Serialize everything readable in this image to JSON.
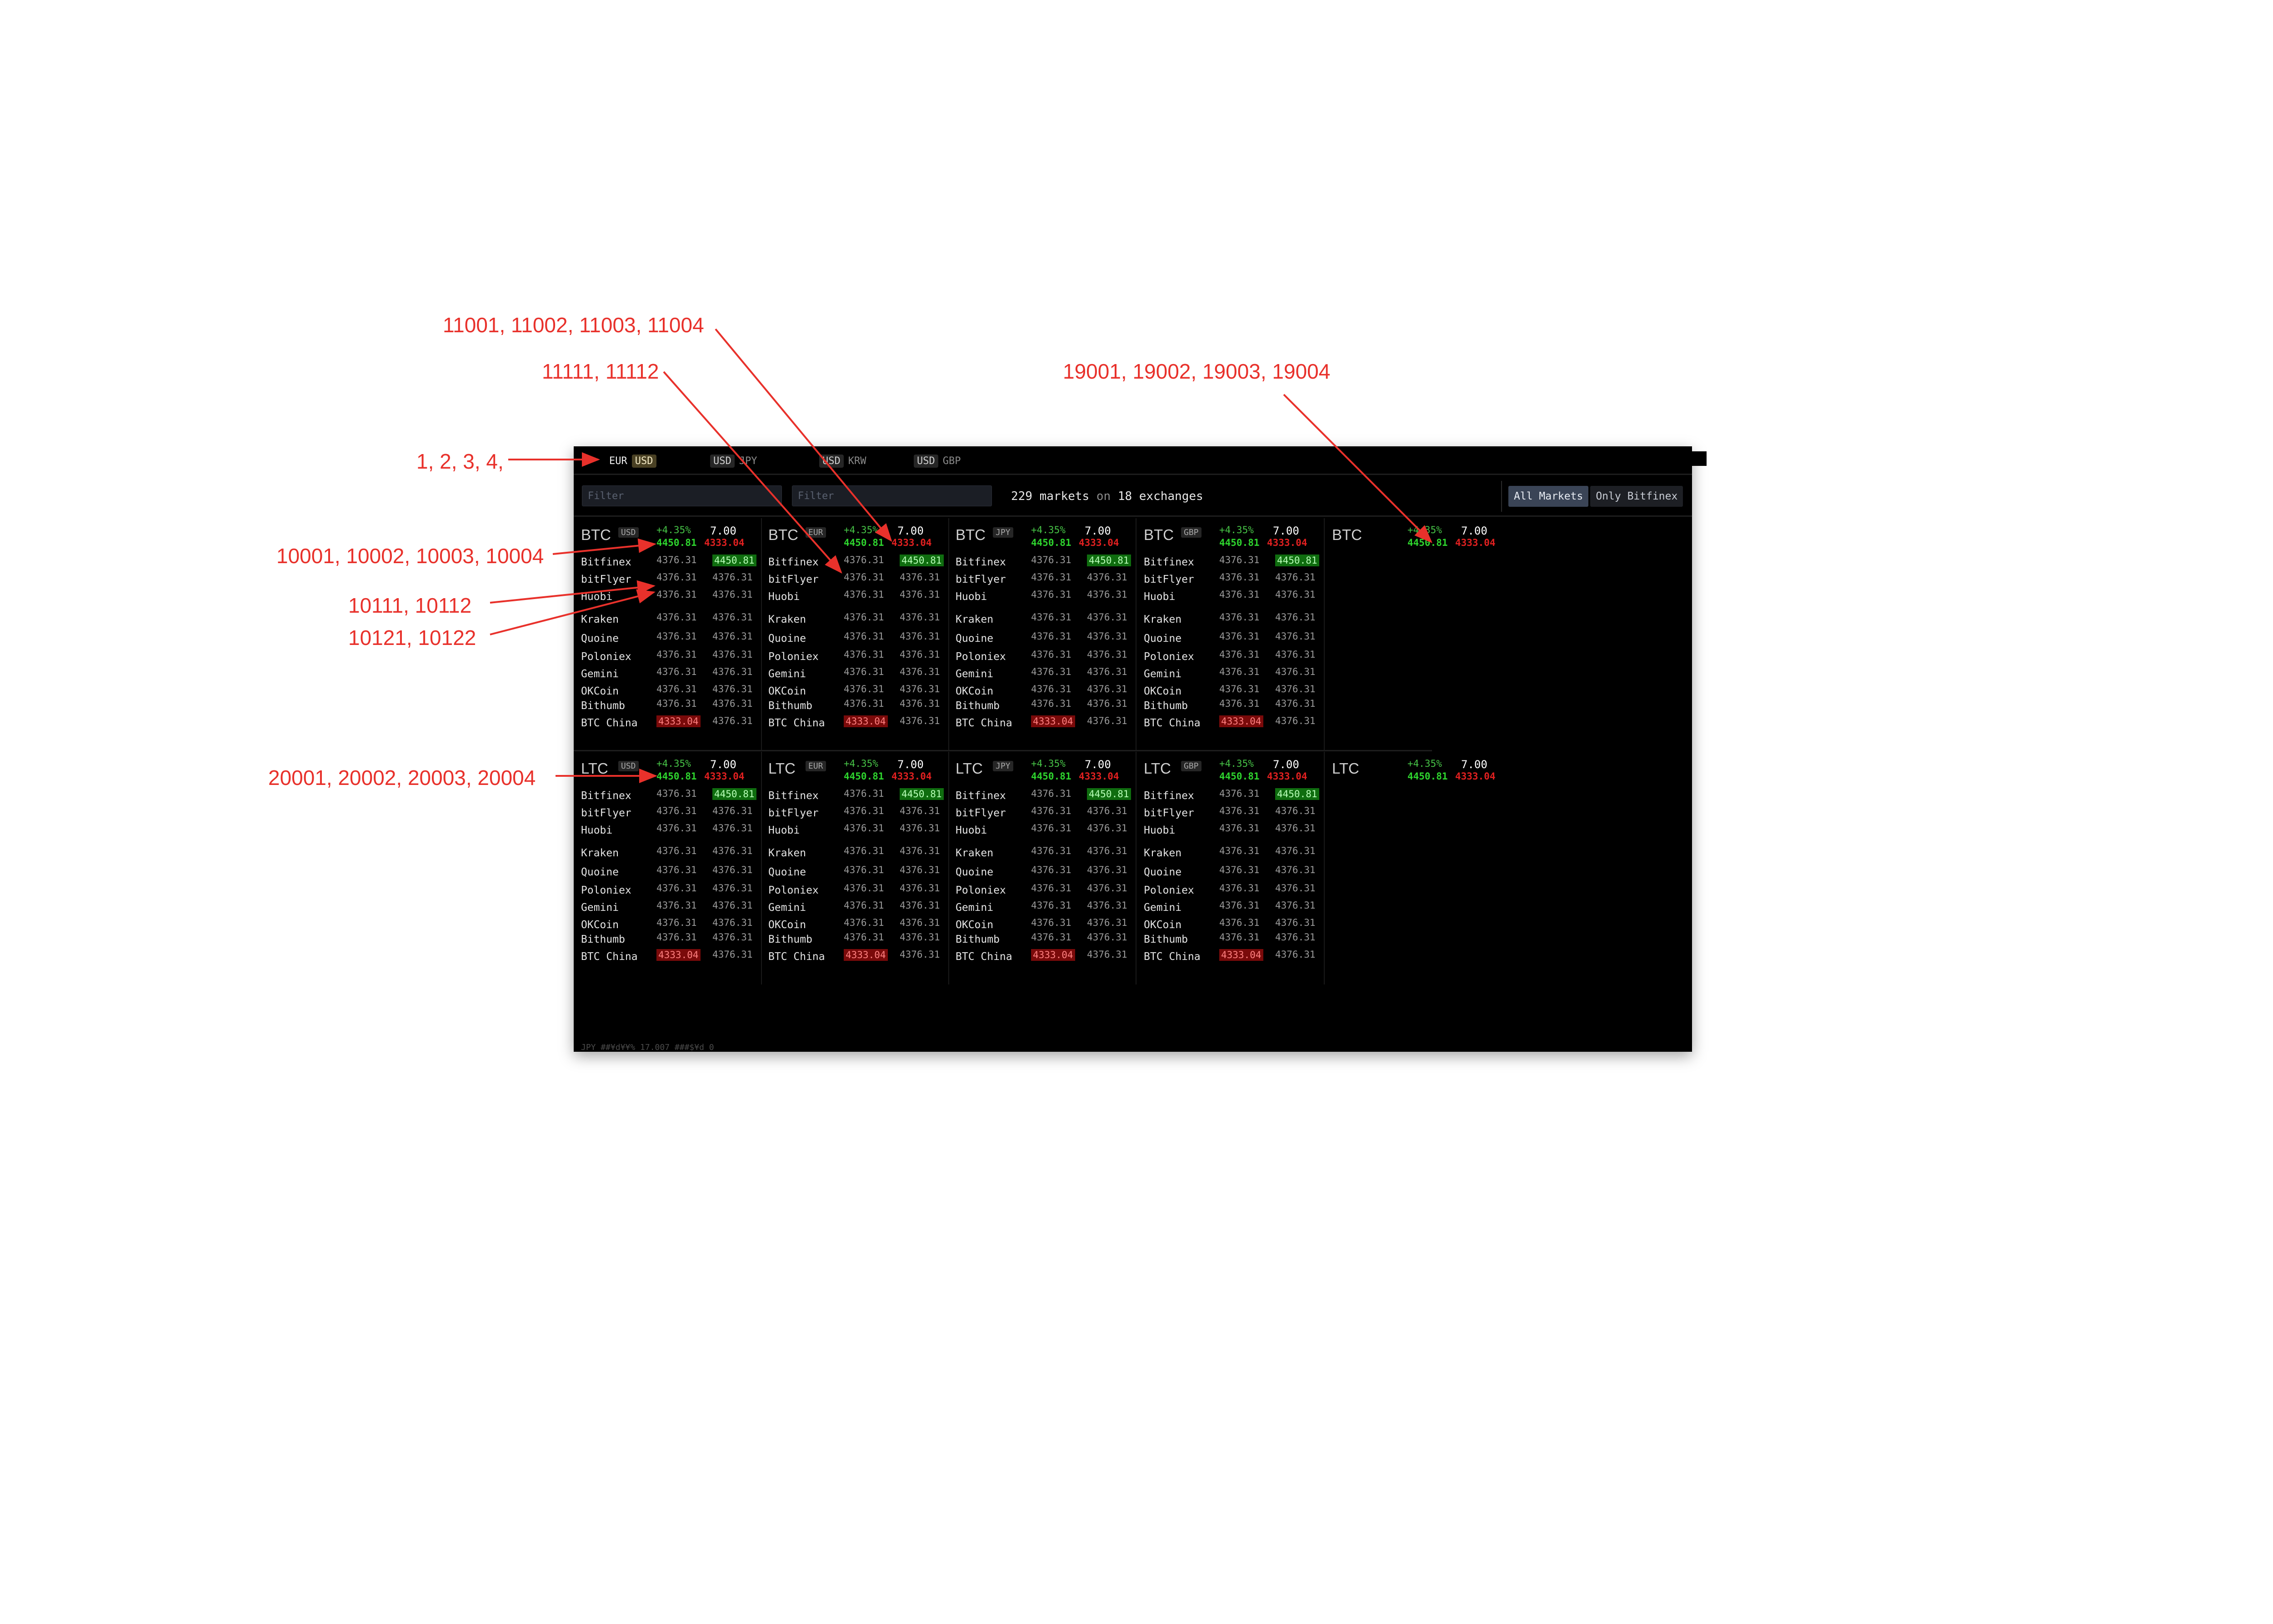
{
  "annotations": {
    "a_top_tabs": "1, 2, 3, 4,",
    "a_11001": "11001, 11002, 11003, 11004",
    "a_11111": "11111, 11112",
    "a_19001": "19001, 19002, 19003, 19004",
    "a_10001": "10001, 10002, 10003, 10004",
    "a_10111": "10111, 10112",
    "a_10121": "10121, 10122",
    "a_20001": "20001, 20002, 20003, 20004"
  },
  "tabs": [
    {
      "left": "EUR",
      "right": "USD",
      "active": true
    },
    {
      "left": "USD",
      "right": "JPY",
      "active": false
    },
    {
      "left": "USD",
      "right": "KRW",
      "active": false
    },
    {
      "left": "USD",
      "right": "GBP",
      "active": false
    }
  ],
  "toolbar": {
    "filter1_placeholder": "Filter",
    "filter2_placeholder": "Filter",
    "markets_count": "229 markets",
    "on_word": "on",
    "exchanges_count": "18 exchanges",
    "all_markets_label": "All Markets",
    "only_bitfinex_label": "Only Bitfinex"
  },
  "panel_header": {
    "change": "+4.35%",
    "value": "7.00",
    "bid": "4450.81",
    "ask": "4333.04"
  },
  "btc_panels": [
    {
      "base": "BTC",
      "quote": "USD"
    },
    {
      "base": "BTC",
      "quote": "EUR"
    },
    {
      "base": "BTC",
      "quote": "JPY"
    },
    {
      "base": "BTC",
      "quote": "GBP"
    },
    {
      "base": "BTC",
      "quote": ""
    }
  ],
  "ltc_panels": [
    {
      "base": "LTC",
      "quote": "USD"
    },
    {
      "base": "LTC",
      "quote": "EUR"
    },
    {
      "base": "LTC",
      "quote": "JPY"
    },
    {
      "base": "LTC",
      "quote": "GBP"
    },
    {
      "base": "LTC",
      "quote": ""
    }
  ],
  "exchanges": [
    "Bitfinex",
    "bitFlyer",
    "Huobi",
    "Kraken",
    "Quoine",
    "Poloniex",
    "Gemini",
    "OKCoin",
    "Bithumb",
    "BTC China"
  ],
  "row_value": "4376.31",
  "highlight_bid": "4450.81",
  "highlight_ask": "4333.04",
  "footer_text": "JPY   ##¥d¥¥%   17.007   ###$¥d   0"
}
